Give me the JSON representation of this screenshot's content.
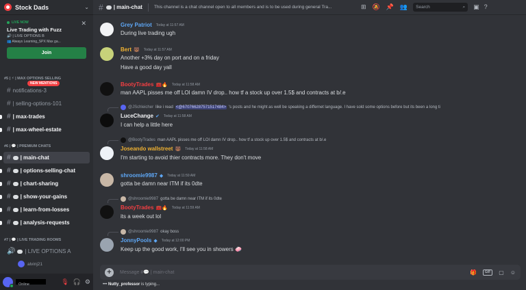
{
  "server": {
    "name": "Stock Dads"
  },
  "live": {
    "status": "LIVE NOW",
    "title": "Live Trading with Fuzz",
    "channel": "| LIVE OPTIONS B",
    "activity": "Always Learning_SPX Max ga...",
    "join_label": "Join"
  },
  "sidebar": {
    "cat1": "#5 | ⚡ | MAX OPTIONS SELLING",
    "new_mentions": "NEW MENTIONS",
    "channels1": [
      {
        "label": "notifications-3"
      },
      {
        "label": "| selling-options-101"
      },
      {
        "label": "| max-trades"
      },
      {
        "label": "| max-wheel-estate"
      }
    ],
    "cat2": "#6 | 💬 | PREMIUM CHATS",
    "channels2": [
      {
        "label": "| main-chat"
      },
      {
        "label": "| options-selling-chat"
      },
      {
        "label": "| chart-sharing"
      },
      {
        "label": "| show-your-gains"
      },
      {
        "label": "| learn-from-losses"
      },
      {
        "label": "| analysis-requests"
      }
    ],
    "cat3": "#7 | 💬 | LIVE TRADING ROOMS",
    "voice_channel": "| LIVE OPTIONS A",
    "voice_user": "alvinj21"
  },
  "user": {
    "status": "Online"
  },
  "header": {
    "channel": "| main-chat",
    "topic": "This channel is a chat channel open to all members and is to be used during general Tra...",
    "search_placeholder": "Search"
  },
  "messages": [
    {
      "author": "Grey Patriot",
      "time": "Today at 11:57 AM",
      "text": "During live trading ugh",
      "color": "#5ea7f5"
    },
    {
      "author": "Bert",
      "time": "Today at 11:57 AM",
      "lines": [
        "Another +3% day on port and on a friday",
        "Have a good day yall"
      ],
      "color": "#f0b232"
    },
    {
      "author": "BootyTrades",
      "time": "Today at 11:58 AM",
      "text": "man AAPL pisses me off LOl damn IV drop.. how tf a stock up over 1.5$ and contracts at b/.e",
      "color": "#f23f42"
    },
    {
      "reply_user": "@JSchleicher",
      "reply_text": "like i read",
      "reply_mention": "<@670766287571517484>",
      "reply_rest": "'s posts and he might as well be speaking a differnet language. I have sold some options before but its been a long ti",
      "author": "LuceChange",
      "time": "Today at 11:58 AM",
      "text": "I can help a little here",
      "color": "#f2f3f5"
    },
    {
      "reply_user": "@BootyTrades",
      "reply_text": "man AAPL pisses me off LOl damn IV drop.. how tf a stock up over 1.5$ and contracts at b/.e",
      "author": "Joseando wallstreet",
      "time": "Today at 11:58 AM",
      "text": "I'm starting to avoid thier contracts more. They don't move",
      "color": "#f0b232"
    },
    {
      "author": "shroomie9987",
      "time": "Today at 11:59 AM",
      "text": "gotta be damn near ITM if its 0dte",
      "color": "#5ea7f5"
    },
    {
      "reply_user": "@shroomie9987",
      "reply_text": "gotta be damn near ITM if its 0dte",
      "author": "BootyTrades",
      "time": "Today at 11:59 AM",
      "text": "its a week out lol",
      "color": "#f23f42"
    },
    {
      "reply_user": "@shroomie9987",
      "reply_text": "okay boss",
      "author": "JonnyPools",
      "time": "Today at 12:00 PM",
      "text": "Keep up the good work, I'll see you in showers",
      "color": "#5ea7f5"
    }
  ],
  "composer": {
    "placeholder": "Message #💬 | main-chat"
  },
  "typing": {
    "user": "Nutty_professor",
    "suffix": "is typing..."
  }
}
